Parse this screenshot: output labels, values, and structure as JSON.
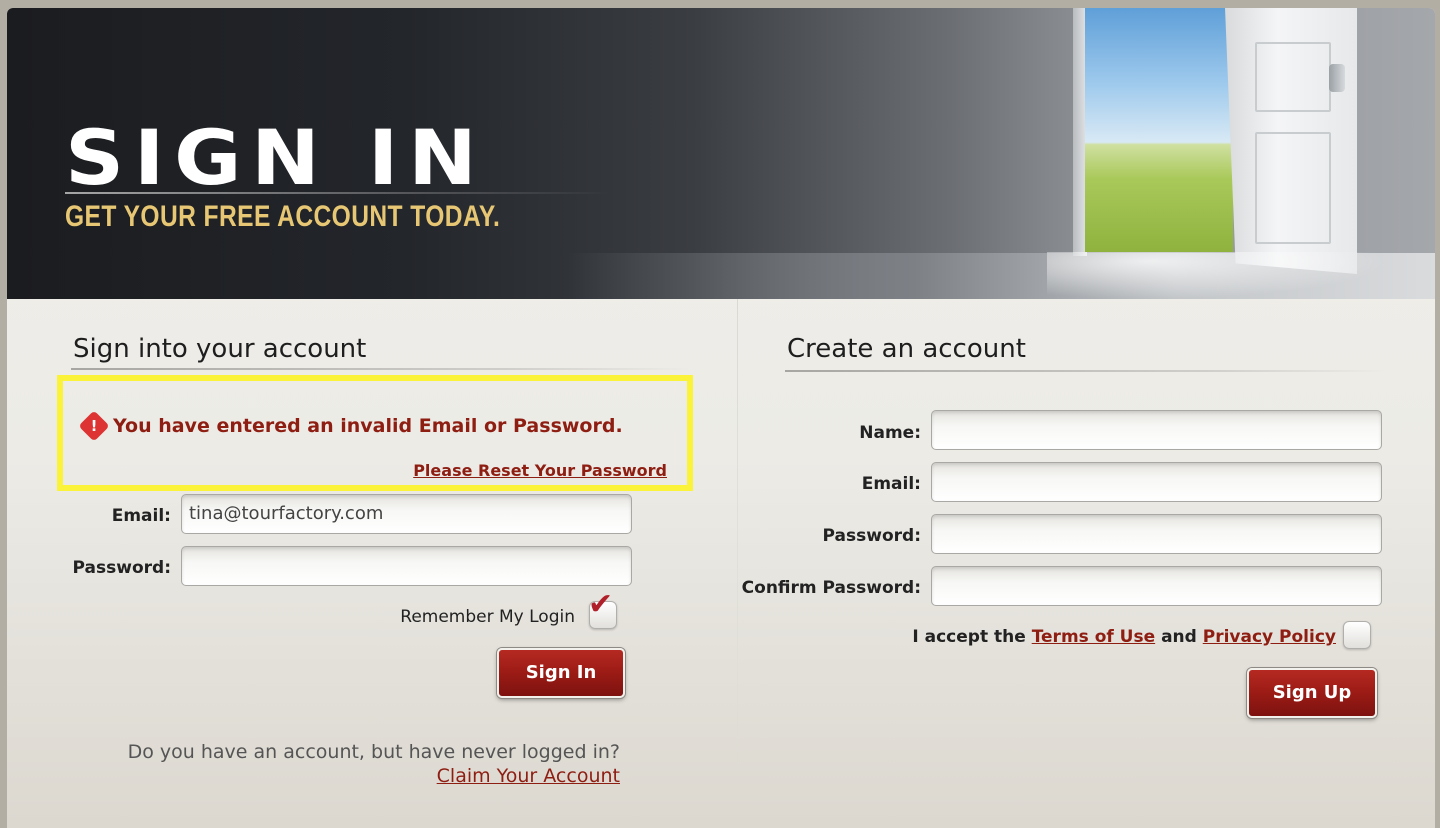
{
  "banner": {
    "title": "SIGN IN",
    "subtitle": "GET YOUR FREE ACCOUNT TODAY."
  },
  "signin": {
    "heading": "Sign into your account",
    "error_message": "You have entered an invalid Email or Password.",
    "reset_link": "Please Reset Your Password",
    "email_label": "Email:",
    "email_value": "tina@tourfactory.com",
    "password_label": "Password:",
    "password_value": "",
    "remember_label": "Remember My Login",
    "remember_checked": true,
    "submit_label": "Sign In",
    "claim_question": "Do you have an account, but have never logged in?",
    "claim_link": "Claim Your Account"
  },
  "signup": {
    "heading": "Create an account",
    "name_label": "Name:",
    "email_label": "Email:",
    "password_label": "Password:",
    "confirm_label": "Confirm Password:",
    "accept_prefix": "I accept the",
    "terms_link": "Terms of Use",
    "and_text": "and",
    "privacy_link": "Privacy Policy",
    "accept_checked": false,
    "submit_label": "Sign Up"
  },
  "colors": {
    "accent_red": "#8e1d12",
    "highlight_yellow": "#fbf33a",
    "banner_gold": "#e7c774"
  },
  "icons": {
    "error": "alert-icon",
    "checkmark": "checkmark-icon"
  }
}
